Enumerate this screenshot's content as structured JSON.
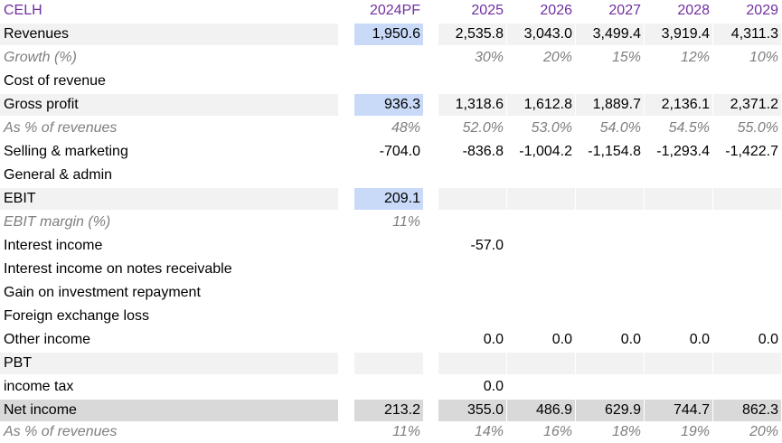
{
  "header": {
    "ticker": "CELH",
    "years": [
      "2024PF",
      "2025",
      "2026",
      "2027",
      "2028",
      "2029"
    ]
  },
  "rows": [
    {
      "label": "Revenues",
      "values": [
        "1,950.6",
        "2,535.8",
        "3,043.0",
        "3,499.4",
        "3,919.4",
        "4,311.3"
      ]
    },
    {
      "label": "Growth (%)",
      "values": [
        "",
        "30%",
        "20%",
        "15%",
        "12%",
        "10%"
      ]
    },
    {
      "label": "Cost of revenue",
      "values": [
        "",
        "",
        "",
        "",
        "",
        ""
      ]
    },
    {
      "label": "Gross profit",
      "values": [
        "936.3",
        "1,318.6",
        "1,612.8",
        "1,889.7",
        "2,136.1",
        "2,371.2"
      ]
    },
    {
      "label": "As % of revenues",
      "values": [
        "48%",
        "52.0%",
        "53.0%",
        "54.0%",
        "54.5%",
        "55.0%"
      ]
    },
    {
      "label": "Selling & marketing",
      "values": [
        "-704.0",
        "-836.8",
        "-1,004.2",
        "-1,154.8",
        "-1,293.4",
        "-1,422.7"
      ]
    },
    {
      "label": "General & admin",
      "values": [
        "",
        "",
        "",
        "",
        "",
        ""
      ]
    },
    {
      "label": "EBIT",
      "values": [
        "209.1",
        "",
        "",
        "",
        "",
        ""
      ]
    },
    {
      "label": "EBIT margin (%)",
      "values": [
        "11%",
        "",
        "",
        "",
        "",
        ""
      ]
    },
    {
      "label": "Interest income",
      "values": [
        "",
        "-57.0",
        "",
        "",
        "",
        ""
      ]
    },
    {
      "label": "Interest income on notes receivable",
      "values": [
        "",
        "",
        "",
        "",
        "",
        ""
      ]
    },
    {
      "label": "Gain on investment repayment",
      "values": [
        "",
        "",
        "",
        "",
        "",
        ""
      ]
    },
    {
      "label": "Foreign exchange loss",
      "values": [
        "",
        "",
        "",
        "",
        "",
        ""
      ]
    },
    {
      "label": "Other income",
      "values": [
        "",
        "0.0",
        "0.0",
        "0.0",
        "0.0",
        "0.0"
      ]
    },
    {
      "label": "PBT",
      "values": [
        "",
        "",
        "",
        "",
        "",
        ""
      ]
    },
    {
      "label": "income tax",
      "values": [
        "",
        "0.0",
        "",
        "",
        "",
        ""
      ]
    },
    {
      "label": "Net income",
      "values": [
        "213.2",
        "355.0",
        "486.9",
        "629.9",
        "744.7",
        "862.3"
      ]
    },
    {
      "label": "As % of revenues",
      "values": [
        "11%",
        "14%",
        "16%",
        "18%",
        "19%",
        "20%"
      ]
    }
  ],
  "colors": {
    "header_text": "#7030a0",
    "band": "#f2f2f2",
    "highlight": "#c9daf8",
    "net_income_band": "#d9d9d9",
    "italic_text": "#7f7f7f"
  }
}
